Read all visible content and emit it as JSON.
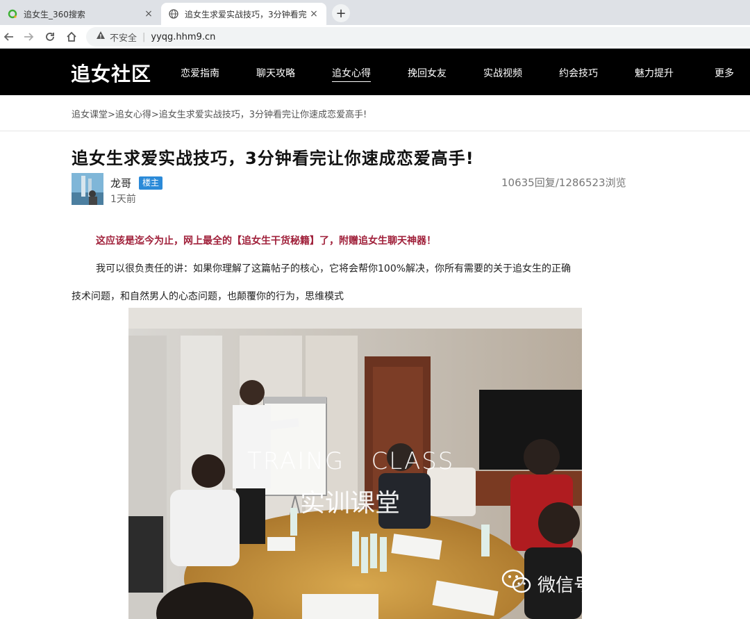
{
  "browser": {
    "tabs": [
      {
        "title": "追女生_360搜索",
        "close": "×"
      },
      {
        "title": "追女生求爱实战技巧，3分钟看完",
        "close": "×"
      }
    ],
    "new_tab": "+",
    "address": {
      "security": "不安全",
      "url": "yyqg.hhm9.cn"
    }
  },
  "site": {
    "logo": "追女社区",
    "nav": [
      "恋爱指南",
      "聊天攻略",
      "追女心得",
      "挽回女友",
      "实战视频",
      "约会技巧",
      "魅力提升",
      "更多"
    ],
    "active_nav": "追女心得"
  },
  "breadcrumb": "追女课堂>追女心得>追女生求爱实战技巧，3分钟看完让你速成恋爱高手!",
  "article": {
    "title": "追女生求爱实战技巧，3分钟看完让你速成恋爱高手!",
    "author": "龙哥",
    "badge": "楼主",
    "time": "1天前",
    "stats": "10635回复/1286523浏览",
    "highlight": "这应该是迄今为止，网上最全的【追女生干货秘籍】了，附赠追女生聊天神器！",
    "para1": "我可以很负责任的讲：如果你理解了这篇帖子的核心，它将会帮你100%解决，你所有需要的关于追女生的正确",
    "para2": "技术问题，和自然男人的心态问题，也颠覆你的行为，思维模式",
    "image": {
      "overlay_en": "TRAING   CLASS",
      "overlay_cn": "实训课堂",
      "watermark": "微信号: mcbang_com"
    }
  }
}
